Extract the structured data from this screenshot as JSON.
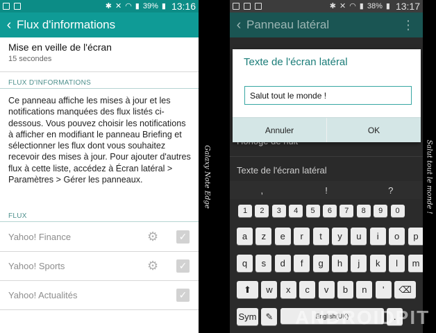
{
  "left": {
    "status": {
      "battery": "39%",
      "time": "13:16"
    },
    "header": {
      "title": "Flux d'informations"
    },
    "setting": {
      "title": "Mise en veille de l'écran",
      "subtitle": "15 secondes"
    },
    "section_flux_info": "FLUX D'INFORMATIONS",
    "description": "Ce panneau affiche les mises à jour et les notifications manquées des flux listés ci-dessous. Vous pouvez choisir les notifications à afficher en modifiant le panneau Briefing et sélectionner les flux dont vous souhaitez recevoir des mises à jour. Pour ajouter d'autres flux à cette liste, accédez à Écran latéral > Paramètres > Gérer les panneaux.",
    "section_flux": "FLUX",
    "feeds": [
      {
        "label": "Yahoo! Finance",
        "has_settings": true,
        "checked": true
      },
      {
        "label": "Yahoo! Sports",
        "has_settings": true,
        "checked": true
      },
      {
        "label": "Yahoo! Actualités",
        "has_settings": false,
        "checked": true
      }
    ],
    "edge_text": "Galaxy Note Edge"
  },
  "right": {
    "status": {
      "battery": "38%",
      "time": "13:17"
    },
    "header": {
      "title": "Panneau latéral"
    },
    "background_rows": [
      "Horloge de nuit",
      "Texte de l'écran latéral"
    ],
    "dialog": {
      "title": "Texte de l'écran latéral",
      "input_value": "Salut tout le monde !",
      "cancel_label": "Annuler",
      "ok_label": "OK"
    },
    "keyboard": {
      "suggestions": [
        ",",
        "!",
        "?"
      ],
      "numbers": [
        "1",
        "2",
        "3",
        "4",
        "5",
        "6",
        "7",
        "8",
        "9",
        "0"
      ],
      "row1": [
        "a",
        "z",
        "e",
        "r",
        "t",
        "y",
        "u",
        "i",
        "o",
        "p"
      ],
      "row2": [
        "q",
        "s",
        "d",
        "f",
        "g",
        "h",
        "j",
        "k",
        "l",
        "m"
      ],
      "row3": [
        "w",
        "x",
        "c",
        "v",
        "b",
        "n",
        "'"
      ],
      "sym_label": "Sym",
      "space_label": "English(UK)",
      "period": "."
    },
    "edge_text": "Salut tout le monde !"
  },
  "watermark": "ANDROIDPIT",
  "colors": {
    "teal": "#0f9b96",
    "teal_dark": "#1a5553",
    "accent_text": "#1a7c78"
  }
}
